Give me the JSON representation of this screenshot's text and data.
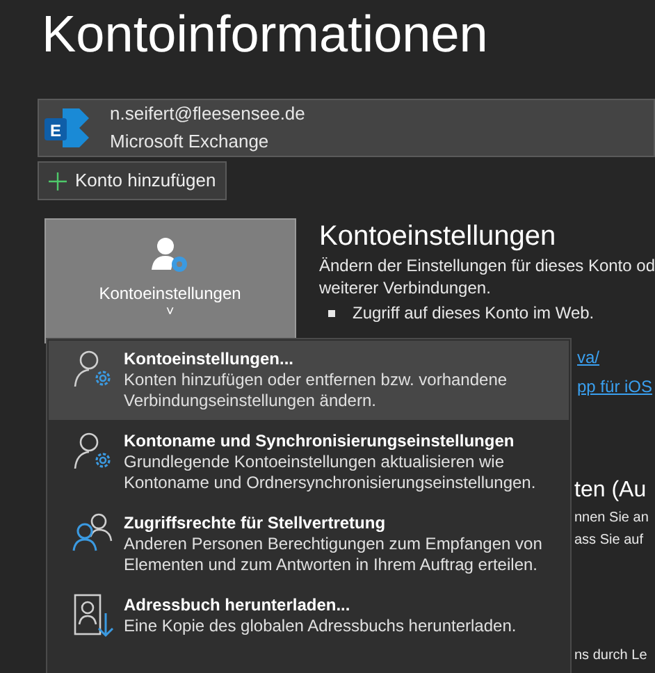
{
  "title": "Kontoinformationen",
  "account": {
    "logo_letter": "E",
    "email": "n.seifert@fleesensee.de",
    "type": "Microsoft Exchange"
  },
  "add_account": "Konto hinzufügen",
  "settings_tile": {
    "label": "Kontoeinstellungen",
    "caret": "˅"
  },
  "settings_section": {
    "heading": "Kontoeinstellungen",
    "description": "Ändern der Einstellungen für dieses Konto od",
    "description_2": "weiterer Verbindungen.",
    "bullet": "Zugriff auf dieses Konto im Web.",
    "links": [
      "va/",
      "pp für iOS"
    ]
  },
  "next_section": {
    "heading": "ten (Au",
    "lines": [
      "nnen Sie an",
      "ass Sie auf"
    ],
    "last_line": "ns durch Le"
  },
  "menu": [
    {
      "kind": "person-gear",
      "title": "Kontoeinstellungen...",
      "description": "Konten hinzufügen oder entfernen bzw. vorhandene Verbindungseinstellungen ändern.",
      "selected": true
    },
    {
      "kind": "person-gear",
      "title": "Kontoname und Synchronisierungseinstellungen",
      "description": "Grundlegende Kontoeinstellungen aktualisieren wie Kontoname und Ordnersynchronisierungseinstellungen.",
      "selected": false
    },
    {
      "kind": "people",
      "title": "Zugriffsrechte für Stellvertretung",
      "description": "Anderen Personen Berechtigungen zum Empfangen von Elementen und zum Antworten in Ihrem Auftrag erteilen.",
      "selected": false
    },
    {
      "kind": "address-book",
      "title": "Adressbuch herunterladen...",
      "description": "Eine Kopie des globalen Adressbuchs herunterladen.",
      "selected": false
    }
  ]
}
